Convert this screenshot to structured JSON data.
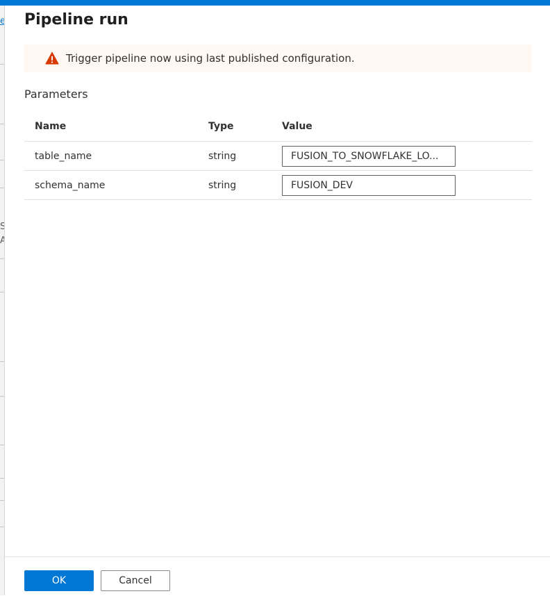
{
  "dialog": {
    "title": "Pipeline run"
  },
  "warning": {
    "message": "Trigger pipeline now using last published configuration.",
    "icon": "warning-icon",
    "color": "#d83b01"
  },
  "parameters": {
    "label": "Parameters",
    "columns": {
      "name": "Name",
      "type": "Type",
      "value": "Value"
    },
    "rows": [
      {
        "name": "table_name",
        "type": "string",
        "value": "FUSION_TO_SNOWFLAKE_LO..."
      },
      {
        "name": "schema_name",
        "type": "string",
        "value": "FUSION_DEV"
      }
    ]
  },
  "footer": {
    "ok_label": "OK",
    "cancel_label": "Cancel"
  },
  "colors": {
    "accent": "#0078d4",
    "warning_background": "#fef7f2"
  },
  "backdrop": {
    "fragments": [
      "e",
      "S",
      "A"
    ]
  }
}
